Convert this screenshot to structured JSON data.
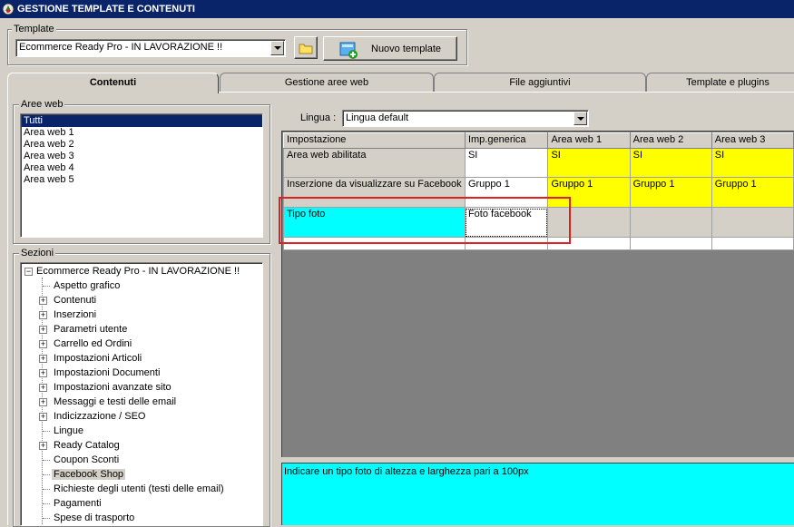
{
  "window": {
    "title": "GESTIONE TEMPLATE E CONTENUTI",
    "icon": "app-icon"
  },
  "template_group": {
    "label": "Template",
    "selected": "Ecommerce Ready Pro - IN LAVORAZIONE !!",
    "new_button_label": "Nuovo template"
  },
  "tabs": [
    {
      "label": "Contenuti",
      "active": true
    },
    {
      "label": "Gestione aree web",
      "active": false
    },
    {
      "label": "File aggiuntivi",
      "active": false
    },
    {
      "label": "Template e plugins",
      "active": false
    }
  ],
  "aree_web": {
    "label": "Aree web",
    "items": [
      "Tutti",
      "Area web 1",
      "Area web 2",
      "Area web 3",
      "Area web 4",
      "Area web 5"
    ],
    "selected": "Tutti"
  },
  "sezioni": {
    "label": "Sezioni",
    "root": "Ecommerce Ready Pro - IN LAVORAZIONE !!",
    "items": [
      {
        "label": "Aspetto grafico",
        "expandable": false
      },
      {
        "label": "Contenuti",
        "expandable": true
      },
      {
        "label": "Inserzioni",
        "expandable": true
      },
      {
        "label": "Parametri utente",
        "expandable": true
      },
      {
        "label": "Carrello ed Ordini",
        "expandable": true
      },
      {
        "label": "Impostazioni Articoli",
        "expandable": true
      },
      {
        "label": "Impostazioni Documenti",
        "expandable": true
      },
      {
        "label": "Impostazioni avanzate sito",
        "expandable": true
      },
      {
        "label": "Messaggi e testi delle email",
        "expandable": true
      },
      {
        "label": "Indicizzazione / SEO",
        "expandable": true
      },
      {
        "label": "Lingue",
        "expandable": false
      },
      {
        "label": "Ready Catalog",
        "expandable": true
      },
      {
        "label": "Coupon Sconti",
        "expandable": false
      },
      {
        "label": "Facebook Shop",
        "expandable": false,
        "selected": true
      },
      {
        "label": "Richieste degli utenti (testi delle email)",
        "expandable": false
      },
      {
        "label": "Pagamenti",
        "expandable": false
      },
      {
        "label": "Spese di trasporto",
        "expandable": false
      }
    ]
  },
  "lingua": {
    "label": "Lingua :",
    "selected": "Lingua default"
  },
  "grid": {
    "headers": [
      "Impostazione",
      "Imp.generica",
      "Area web 1",
      "Area web 2",
      "Area web 3"
    ],
    "rows": [
      {
        "label": "Area web abilitata",
        "generic": "SI",
        "areas": [
          "SI",
          "SI",
          "SI"
        ]
      },
      {
        "label": "Inserzione da visualizzare su Facebook",
        "generic": "Gruppo 1",
        "areas": [
          "Gruppo 1",
          "Gruppo 1",
          "Gruppo 1"
        ]
      },
      {
        "label": "Tipo foto",
        "generic": "Foto facebook",
        "areas": [
          "",
          "",
          ""
        ]
      }
    ]
  },
  "description": "Indicare un tipo foto di altezza e larghezza pari a 100px",
  "colors": {
    "titlebar": "#0a246a",
    "yellow_cells": "#ffff00",
    "cyan_cells": "#00ffff",
    "highlight_box": "#e02020"
  }
}
